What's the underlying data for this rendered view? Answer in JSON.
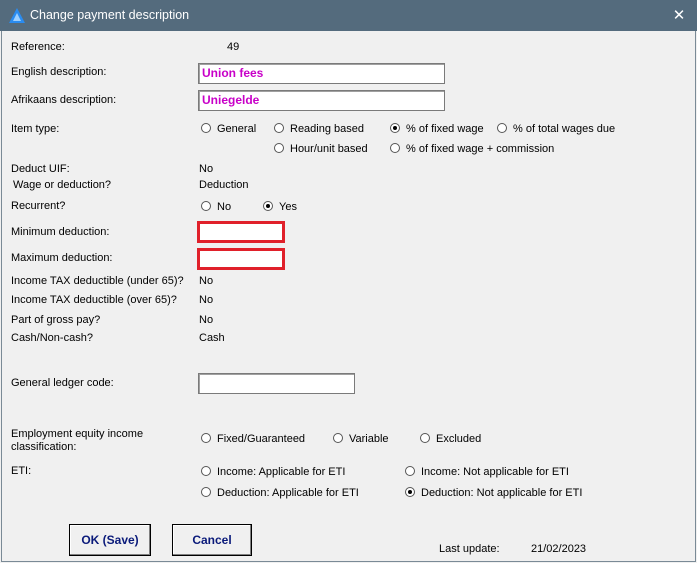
{
  "window": {
    "title": "Change payment description",
    "close_glyph": "✕"
  },
  "form": {
    "reference": {
      "label": "Reference:",
      "value": "49"
    },
    "english_description": {
      "label": "English description:",
      "value": "Union fees"
    },
    "afrikaans_description": {
      "label": "Afrikaans description:",
      "value": "Uniegelde"
    },
    "item_type": {
      "label": "Item type:",
      "options": [
        "General",
        "Reading based",
        "% of fixed wage",
        "% of total wages due",
        "Hour/unit based",
        "% of fixed wage + commission"
      ],
      "selected": "% of fixed wage"
    },
    "deduct_uif": {
      "label": "Deduct UIF:",
      "value": "No"
    },
    "wage_or_deduction": {
      "label": "Wage or deduction?",
      "value": "Deduction"
    },
    "recurrent": {
      "label": "Recurrent?",
      "options": [
        "No",
        "Yes"
      ],
      "selected": "Yes"
    },
    "minimum_deduction": {
      "label": "Minimum deduction:",
      "value": ""
    },
    "maximum_deduction": {
      "label": "Maximum deduction:",
      "value": ""
    },
    "tax_under_65": {
      "label": "Income TAX deductible (under 65)?",
      "value": "No"
    },
    "tax_over_65": {
      "label": "Income TAX deductible (over 65)?",
      "value": "No"
    },
    "part_of_gross": {
      "label": "Part of gross pay?",
      "value": "No"
    },
    "cash_noncash": {
      "label": "Cash/Non-cash?",
      "value": "Cash"
    },
    "gl_code": {
      "label": "General ledger code:",
      "value": ""
    },
    "ee_classification": {
      "label_line1": "Employment equity income",
      "label_line2": "classification:",
      "options": [
        "Fixed/Guaranteed",
        "Variable",
        "Excluded"
      ],
      "selected": ""
    },
    "eti": {
      "label": "ETI:",
      "options": [
        "Income: Applicable for ETI",
        "Income: Not applicable for ETI",
        "Deduction: Applicable for ETI",
        "Deduction: Not applicable for ETI"
      ],
      "selected": "Deduction: Not applicable for ETI"
    }
  },
  "buttons": {
    "ok": "OK (Save)",
    "cancel": "Cancel"
  },
  "footer": {
    "last_update_label": "Last update:",
    "last_update_value": "21/02/2023"
  },
  "colors": {
    "titlebar": "#546b7d",
    "description_text": "#c800c8",
    "required_border": "#e0202a",
    "button_text": "#0a1a7a"
  }
}
